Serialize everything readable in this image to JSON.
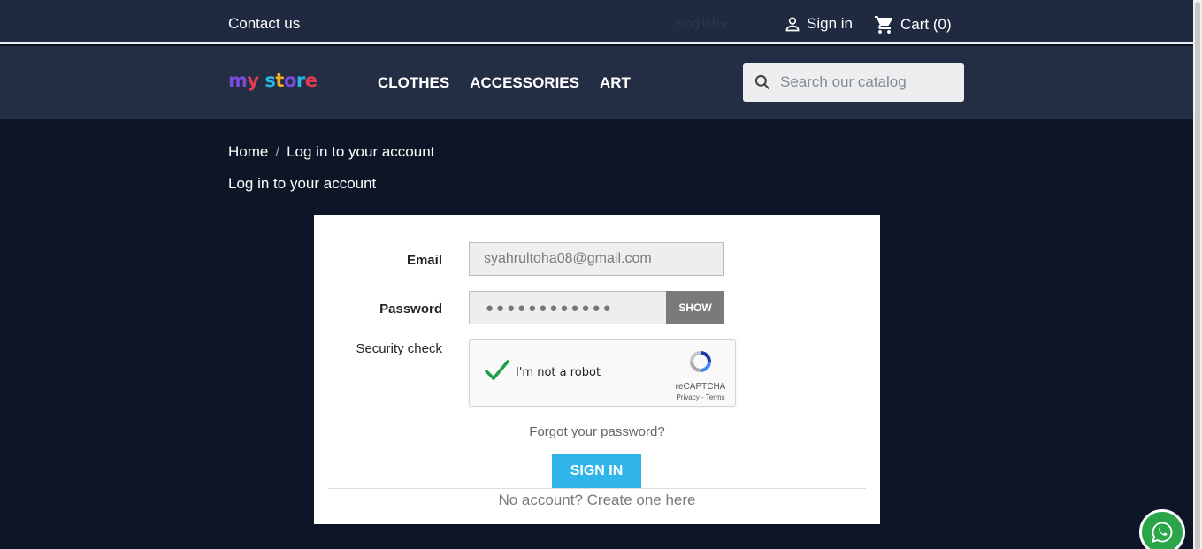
{
  "topbar": {
    "contact": "Contact us",
    "language": "English",
    "sign_in": "Sign in",
    "cart": "Cart (0)"
  },
  "navbar": {
    "logo": "my store",
    "menu": [
      "CLOTHES",
      "ACCESSORIES",
      "ART"
    ],
    "search_placeholder": "Search our catalog"
  },
  "breadcrumb": {
    "home": "Home",
    "separator": "/",
    "current": "Log in to your account"
  },
  "page_title": "Log in to your account",
  "form": {
    "email_label": "Email",
    "email_value": "syahrultoha08@gmail.com",
    "password_label": "Password",
    "password_mask": "●●●●●●●●●●●●",
    "show_label": "SHOW",
    "security_label": "Security check",
    "captcha": {
      "text": "I'm not a robot",
      "brand": "reCAPTCHA",
      "links": "Privacy - Terms"
    },
    "forgot": "Forgot your password?",
    "submit": "SIGN IN",
    "no_account": "No account? Create one here"
  },
  "colors": {
    "background": "#0e1527",
    "header": "#232d44",
    "accent": "#2fb5e8",
    "check": "#1e9e4b"
  }
}
